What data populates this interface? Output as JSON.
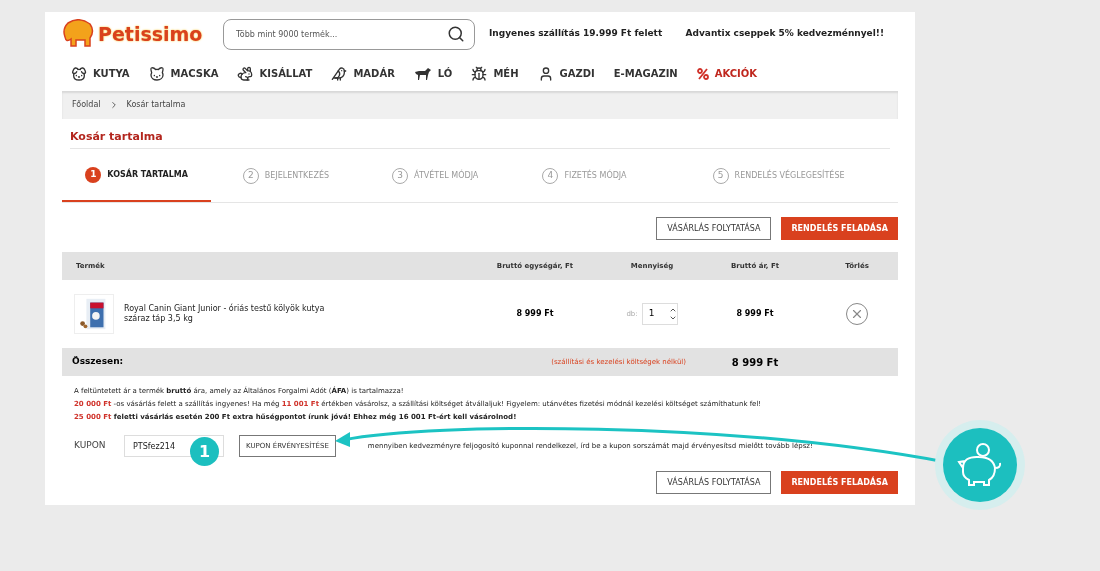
{
  "header": {
    "logo": "Petissimo",
    "search": {
      "placeholder": "Több mint 9000 termék..."
    },
    "promos": [
      "Ingyenes szállítás 19.999 Ft felett",
      "Advantix cseppek 5% kedvezménnyel!!"
    ]
  },
  "nav": [
    {
      "label": "KUTYA",
      "highlight": false
    },
    {
      "label": "MACSKA",
      "highlight": false
    },
    {
      "label": "KISÁLLAT",
      "highlight": false
    },
    {
      "label": "MADÁR",
      "highlight": false
    },
    {
      "label": "LÓ",
      "highlight": false
    },
    {
      "label": "MÉH",
      "highlight": false
    },
    {
      "label": "GAZDI",
      "highlight": false
    },
    {
      "label": "E-MAGAZIN",
      "highlight": false
    },
    {
      "label": "AKCIÓK",
      "highlight": true
    }
  ],
  "breadcrumb": [
    "Főoldal",
    "Kosár tartalma"
  ],
  "page_title": "Kosár tartalma",
  "steps": [
    {
      "number": "1",
      "label": "KOSÁR TARTALMA",
      "selected": true
    },
    {
      "number": "2",
      "label": "BEJELENTKEZÉS",
      "selected": false
    },
    {
      "number": "3",
      "label": "ÁTVÉTEL MÓDJA",
      "selected": false
    },
    {
      "number": "4",
      "label": "FIZETÉS MÓDJA",
      "selected": false
    },
    {
      "number": "5",
      "label": "RENDELÉS VÉGLEGESÍTÉSE",
      "selected": false
    }
  ],
  "top_actions": {
    "continue": "VÁSÁRLÁS FOLYTATÁSA",
    "order": "RENDELÉS FELADÁSA"
  },
  "table": {
    "columns": [
      "Termék",
      "Bruttó egységár, Ft",
      "Mennyiség",
      "Bruttó ár, Ft",
      "Törlés"
    ],
    "rows": [
      {
        "product": "Royal Canin Giant Junior - óriás testű kölyök kutya száraz táp 3,5 kg",
        "unit_price": "8 999 Ft",
        "qty_label": "db:",
        "qty": "1",
        "price": "8 999 Ft"
      }
    ],
    "total": {
      "label": "Összesen:",
      "note": "(szállítási és kezelési költségek nélkül)",
      "value": "8 999 Ft"
    }
  },
  "notes": [
    [
      {
        "kind": "rich",
        "text": "A feltüntetett ár a termék **bruttó** ára, amely az Általános Forgalmi Adót (**ÁFA**) is tartalmazza!"
      }
    ],
    [
      {
        "kind": "accent",
        "text": "20 000 Ft"
      },
      {
        "kind": "plain",
        "text": " -os vásárlás felett a szállítás ingyenes! Ha még "
      },
      {
        "kind": "accent",
        "text": "11 001 Ft"
      },
      {
        "kind": "plain",
        "text": " értékben vásárolsz, a szállítási költséget átvállaljuk! Figyelem: utánvétes fizetési módnál kezelési költséget számíthatunk fel!"
      }
    ],
    [
      {
        "kind": "accent",
        "text": "25 000 Ft"
      },
      {
        "kind": "bold",
        "text": " feletti vásárlás esetén 200 Ft extra hűségpontot írunk jóvá! Ehhez még 16 001 Ft-ért kell vásárolnod!"
      }
    ]
  ],
  "coupon": {
    "label": "KUPON",
    "value": "PTSfez214",
    "button": "KUPON ÉRVÉNYESÍTÉSE",
    "hint": "mennyiben kedvezményre feljogosító kuponnal rendelkezel, írd be a kupon sorszámát majd érvényesítsd mielőtt tovább lépsz!"
  },
  "bottom_actions": {
    "continue": "VÁSÁRLÁS FOLYTATÁSA",
    "order": "RENDELÉS FELADÁSA"
  },
  "callout": {
    "badge": "1"
  }
}
